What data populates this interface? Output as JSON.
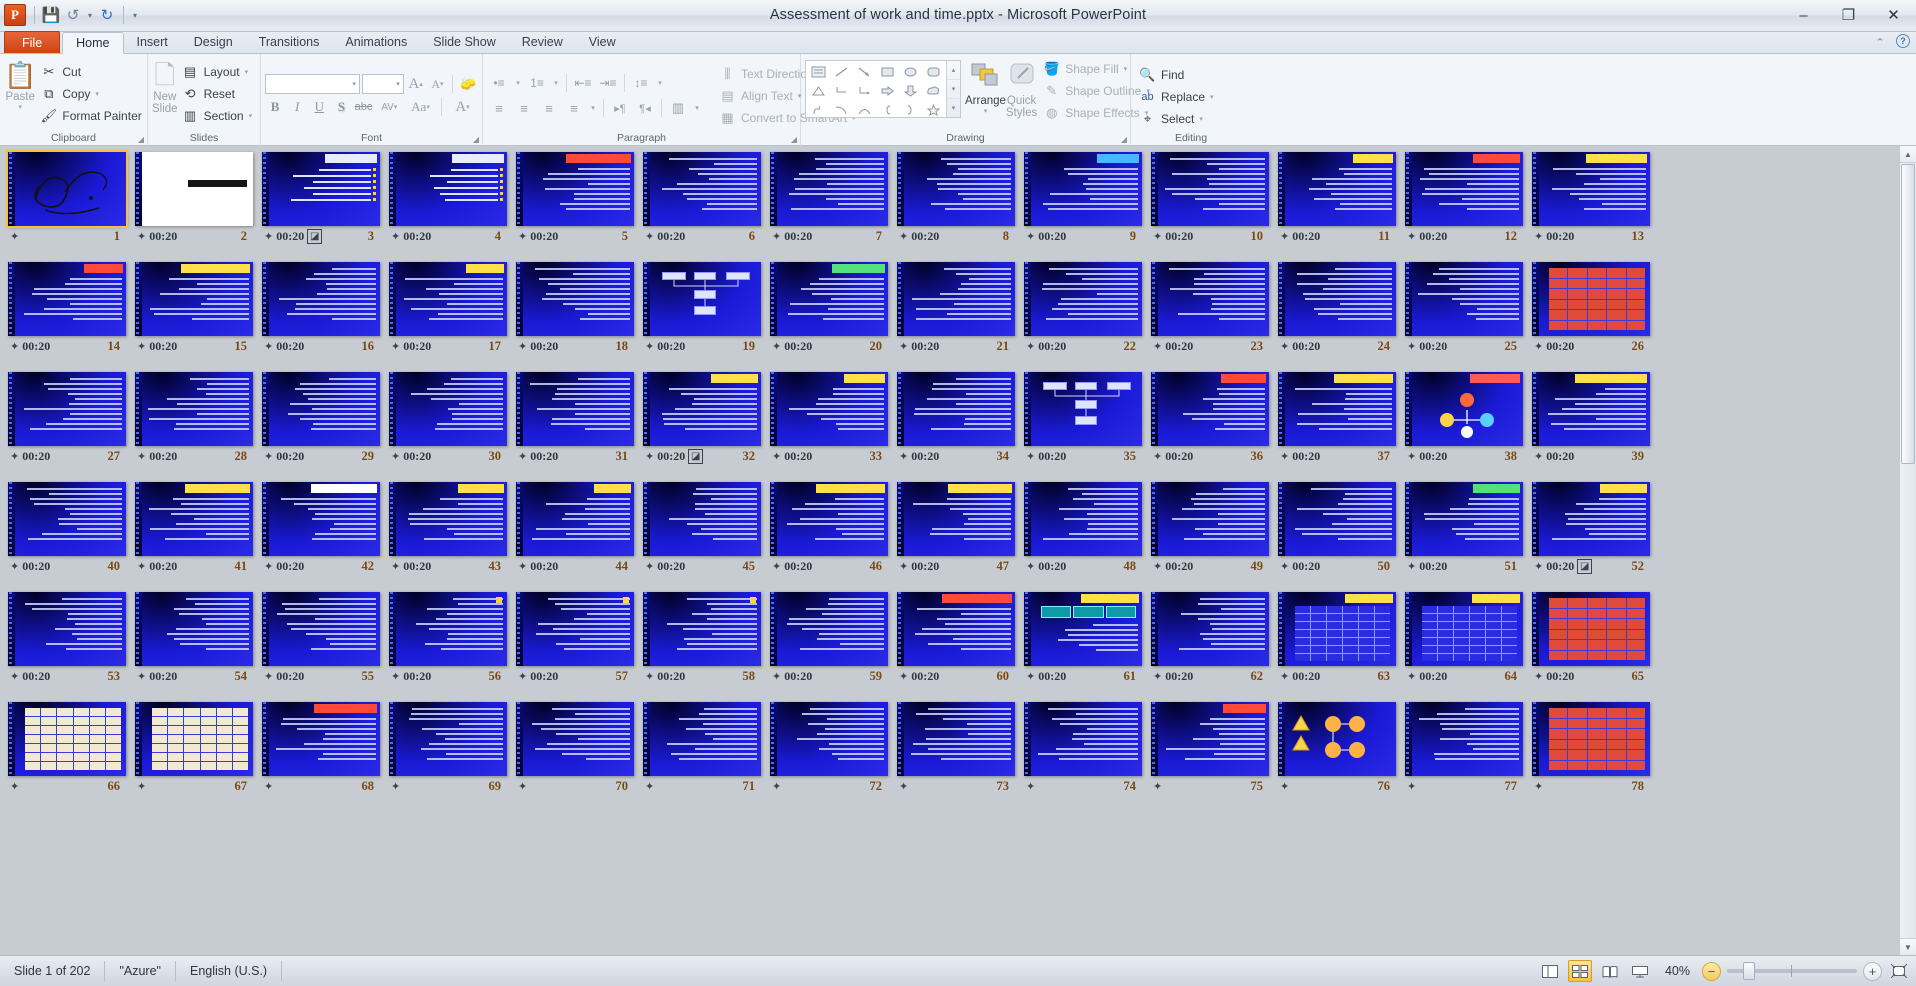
{
  "window": {
    "title": "Assessment of work and time.pptx  -  Microsoft PowerPoint",
    "minimize": "–",
    "restore": "❐",
    "close": "✕"
  },
  "qat": {
    "app_icon": "P",
    "save": "💾",
    "undo": "↺",
    "undo_caret": "▾",
    "redo": "↻",
    "customize": "▾"
  },
  "tabs": [
    {
      "label": "File",
      "kind": "file"
    },
    {
      "label": "Home",
      "kind": "active"
    },
    {
      "label": "Insert",
      "kind": "normal"
    },
    {
      "label": "Design",
      "kind": "normal"
    },
    {
      "label": "Transitions",
      "kind": "normal"
    },
    {
      "label": "Animations",
      "kind": "normal"
    },
    {
      "label": "Slide Show",
      "kind": "normal"
    },
    {
      "label": "Review",
      "kind": "normal"
    },
    {
      "label": "View",
      "kind": "normal"
    }
  ],
  "tabstrip_right": {
    "minimize_ribbon": "⌃",
    "help": "?"
  },
  "ribbon": {
    "clipboard": {
      "label": "Clipboard",
      "paste": "Paste",
      "paste_caret": "▾",
      "cut": "Cut",
      "copy": "Copy",
      "copy_caret": "▾",
      "format_painter": "Format Painter",
      "dialog_launcher": "◢"
    },
    "slides": {
      "label": "Slides",
      "new_slide_line1": "New",
      "new_slide_line2": "Slide",
      "new_slide_caret": "▾",
      "layout": "Layout",
      "layout_caret": "▾",
      "reset": "Reset",
      "section": "Section",
      "section_caret": "▾"
    },
    "font": {
      "label": "Font",
      "font_name_value": "",
      "font_size_value": "",
      "grow_font": "A",
      "shrink_font": "A",
      "clear_formatting": "A",
      "bold": "B",
      "italic": "I",
      "underline": "U",
      "shadow": "S",
      "strikethrough": "abc",
      "character_spacing": "AV",
      "change_case": "Aa",
      "font_color": "A",
      "dialog_launcher": "◢"
    },
    "paragraph": {
      "label": "Paragraph",
      "bullets": "•≡",
      "numbering": "1≡",
      "decrease_indent": "⇤≡",
      "increase_indent": "⇥≡",
      "line_spacing": "↕≡",
      "align_left": "≡",
      "align_center": "≡",
      "align_right": "≡",
      "justify": "≡",
      "text_direction_ltr": "▸¶",
      "text_direction_rtl": "¶◂",
      "columns": "▥",
      "text_direction": "Text Direction",
      "align_text": "Align Text",
      "convert_to_smartart": "Convert to SmartArt",
      "dialog_launcher": "◢"
    },
    "drawing": {
      "label": "Drawing",
      "arrange": "Arrange",
      "arrange_caret": "▾",
      "quick_styles_line1": "Quick",
      "quick_styles_line2": "Styles",
      "quick_styles_caret": "▾",
      "shape_fill": "Shape Fill",
      "shape_outline": "Shape Outline",
      "shape_effects": "Shape Effects",
      "dialog_launcher": "◢",
      "shapes": [
        "textbox-shape",
        "line-shape",
        "arrow-shape",
        "rectangle-shape",
        "oval-shape",
        "rounded-rectangle-shape",
        "triangle-shape",
        "elbow-connector-shape",
        "elbow-arrow-connector-shape",
        "right-arrow-shape",
        "down-arrow-shape",
        "cloud-shape",
        "freeform-shape",
        "curve-shape",
        "arc-shape",
        "left-brace-shape",
        "right-brace-shape",
        "star-shape"
      ],
      "gallery_up": "▴",
      "gallery_down": "▾",
      "gallery_more": "▾"
    },
    "editing": {
      "label": "Editing",
      "find": "Find",
      "replace": "Replace",
      "replace_caret": "▾",
      "select": "Select",
      "select_caret": "▾"
    }
  },
  "sorter": {
    "timing_label": "00:20",
    "slide_count": 78,
    "selected_index": 1,
    "transition_icon": "◪",
    "star_icon": "✦",
    "slides": [
      {
        "n": 1,
        "style": "calligraphy",
        "timing": "",
        "sel": true,
        "trans": false
      },
      {
        "n": 2,
        "style": "white-title",
        "timing": "00:20",
        "sel": false,
        "trans": false
      },
      {
        "n": 3,
        "style": "bullets",
        "timing": "00:20",
        "sel": false,
        "trans": true
      },
      {
        "n": 4,
        "style": "bullets",
        "timing": "00:20",
        "sel": false,
        "trans": false
      },
      {
        "n": 5,
        "style": "title-red",
        "timing": "00:20",
        "sel": false,
        "trans": false
      },
      {
        "n": 6,
        "style": "text",
        "timing": "00:20",
        "sel": false,
        "trans": false
      },
      {
        "n": 7,
        "style": "text",
        "timing": "00:20",
        "sel": false,
        "trans": false
      },
      {
        "n": 8,
        "style": "text",
        "timing": "00:20",
        "sel": false,
        "trans": false
      },
      {
        "n": 9,
        "style": "text-blue",
        "timing": "00:20",
        "sel": false,
        "trans": false
      },
      {
        "n": 10,
        "style": "text",
        "timing": "00:20",
        "sel": false,
        "trans": false
      },
      {
        "n": 11,
        "style": "title-yellow",
        "timing": "00:20",
        "sel": false,
        "trans": false
      },
      {
        "n": 12,
        "style": "title-red",
        "timing": "00:20",
        "sel": false,
        "trans": false
      },
      {
        "n": 13,
        "style": "title-yellow",
        "timing": "00:20",
        "sel": false,
        "trans": false
      },
      {
        "n": 14,
        "style": "title-red",
        "timing": "00:20",
        "sel": false,
        "trans": false
      },
      {
        "n": 15,
        "style": "title-yellow",
        "timing": "00:20",
        "sel": false,
        "trans": false
      },
      {
        "n": 16,
        "style": "text",
        "timing": "00:20",
        "sel": false,
        "trans": false
      },
      {
        "n": 17,
        "style": "title-yellow",
        "timing": "00:20",
        "sel": false,
        "trans": false
      },
      {
        "n": 18,
        "style": "text",
        "timing": "00:20",
        "sel": false,
        "trans": false
      },
      {
        "n": 19,
        "style": "diagram",
        "timing": "00:20",
        "sel": false,
        "trans": false
      },
      {
        "n": 20,
        "style": "title-green",
        "timing": "00:20",
        "sel": false,
        "trans": false
      },
      {
        "n": 21,
        "style": "text",
        "timing": "00:20",
        "sel": false,
        "trans": false
      },
      {
        "n": 22,
        "style": "text",
        "timing": "00:20",
        "sel": false,
        "trans": false
      },
      {
        "n": 23,
        "style": "text",
        "timing": "00:20",
        "sel": false,
        "trans": false
      },
      {
        "n": 24,
        "style": "text",
        "timing": "00:20",
        "sel": false,
        "trans": false
      },
      {
        "n": 25,
        "style": "text",
        "timing": "00:20",
        "sel": false,
        "trans": false
      },
      {
        "n": 26,
        "style": "table-red",
        "timing": "00:20",
        "sel": false,
        "trans": false
      },
      {
        "n": 27,
        "style": "text",
        "timing": "00:20",
        "sel": false,
        "trans": false
      },
      {
        "n": 28,
        "style": "text",
        "timing": "00:20",
        "sel": false,
        "trans": false
      },
      {
        "n": 29,
        "style": "text",
        "timing": "00:20",
        "sel": false,
        "trans": false
      },
      {
        "n": 30,
        "style": "text",
        "timing": "00:20",
        "sel": false,
        "trans": false
      },
      {
        "n": 31,
        "style": "text",
        "timing": "00:20",
        "sel": false,
        "trans": false
      },
      {
        "n": 32,
        "style": "title-yellow",
        "timing": "00:20",
        "sel": false,
        "trans": true
      },
      {
        "n": 33,
        "style": "title-yellow",
        "timing": "00:20",
        "sel": false,
        "trans": false
      },
      {
        "n": 34,
        "style": "text",
        "timing": "00:20",
        "sel": false,
        "trans": false
      },
      {
        "n": 35,
        "style": "diagram",
        "timing": "00:20",
        "sel": false,
        "trans": false
      },
      {
        "n": 36,
        "style": "title-red",
        "timing": "00:20",
        "sel": false,
        "trans": false
      },
      {
        "n": 37,
        "style": "title-yellow",
        "timing": "00:20",
        "sel": false,
        "trans": false
      },
      {
        "n": 38,
        "style": "circle-diag",
        "timing": "00:20",
        "sel": false,
        "trans": false
      },
      {
        "n": 39,
        "style": "title-yellow",
        "timing": "00:20",
        "sel": false,
        "trans": false
      },
      {
        "n": 40,
        "style": "text",
        "timing": "00:20",
        "sel": false,
        "trans": false
      },
      {
        "n": 41,
        "style": "title-yellow",
        "timing": "00:20",
        "sel": false,
        "trans": false
      },
      {
        "n": 42,
        "style": "title-white",
        "timing": "00:20",
        "sel": false,
        "trans": false
      },
      {
        "n": 43,
        "style": "title-yellow",
        "timing": "00:20",
        "sel": false,
        "trans": false
      },
      {
        "n": 44,
        "style": "title-yellow",
        "timing": "00:20",
        "sel": false,
        "trans": false
      },
      {
        "n": 45,
        "style": "text",
        "timing": "00:20",
        "sel": false,
        "trans": false
      },
      {
        "n": 46,
        "style": "title-yellow",
        "timing": "00:20",
        "sel": false,
        "trans": false
      },
      {
        "n": 47,
        "style": "title-yellow",
        "timing": "00:20",
        "sel": false,
        "trans": false
      },
      {
        "n": 48,
        "style": "text",
        "timing": "00:20",
        "sel": false,
        "trans": false
      },
      {
        "n": 49,
        "style": "text",
        "timing": "00:20",
        "sel": false,
        "trans": false
      },
      {
        "n": 50,
        "style": "text",
        "timing": "00:20",
        "sel": false,
        "trans": false
      },
      {
        "n": 51,
        "style": "title-green",
        "timing": "00:20",
        "sel": false,
        "trans": false
      },
      {
        "n": 52,
        "style": "title-yellow",
        "timing": "00:20",
        "sel": false,
        "trans": true
      },
      {
        "n": 53,
        "style": "text",
        "timing": "00:20",
        "sel": false,
        "trans": false
      },
      {
        "n": 54,
        "style": "text",
        "timing": "00:20",
        "sel": false,
        "trans": false
      },
      {
        "n": 55,
        "style": "text",
        "timing": "00:20",
        "sel": false,
        "trans": false
      },
      {
        "n": 56,
        "style": "text-note",
        "timing": "00:20",
        "sel": false,
        "trans": false
      },
      {
        "n": 57,
        "style": "text-note",
        "timing": "00:20",
        "sel": false,
        "trans": false
      },
      {
        "n": 58,
        "style": "text-note",
        "timing": "00:20",
        "sel": false,
        "trans": false
      },
      {
        "n": 59,
        "style": "text",
        "timing": "00:20",
        "sel": false,
        "trans": false
      },
      {
        "n": 60,
        "style": "title-red",
        "timing": "00:20",
        "sel": false,
        "trans": false
      },
      {
        "n": 61,
        "style": "diagram-box",
        "timing": "00:20",
        "sel": false,
        "trans": false
      },
      {
        "n": 62,
        "style": "text",
        "timing": "00:20",
        "sel": false,
        "trans": false
      },
      {
        "n": 63,
        "style": "table-grid",
        "timing": "00:20",
        "sel": false,
        "trans": false
      },
      {
        "n": 64,
        "style": "table-grid",
        "timing": "00:20",
        "sel": false,
        "trans": false
      },
      {
        "n": 65,
        "style": "table-red",
        "timing": "00:20",
        "sel": false,
        "trans": false
      },
      {
        "n": 66,
        "style": "table-tan",
        "timing": "",
        "sel": false,
        "trans": false
      },
      {
        "n": 67,
        "style": "table-tan",
        "timing": "",
        "sel": false,
        "trans": false
      },
      {
        "n": 68,
        "style": "title-red",
        "timing": "",
        "sel": false,
        "trans": false
      },
      {
        "n": 69,
        "style": "text",
        "timing": "",
        "sel": false,
        "trans": false
      },
      {
        "n": 70,
        "style": "text",
        "timing": "",
        "sel": false,
        "trans": false
      },
      {
        "n": 71,
        "style": "text",
        "timing": "",
        "sel": false,
        "trans": false
      },
      {
        "n": 72,
        "style": "text",
        "timing": "",
        "sel": false,
        "trans": false
      },
      {
        "n": 73,
        "style": "text",
        "timing": "",
        "sel": false,
        "trans": false
      },
      {
        "n": 74,
        "style": "text",
        "timing": "",
        "sel": false,
        "trans": false
      },
      {
        "n": 75,
        "style": "title-red",
        "timing": "",
        "sel": false,
        "trans": false
      },
      {
        "n": 76,
        "style": "flow-diag",
        "timing": "",
        "sel": false,
        "trans": false
      },
      {
        "n": 77,
        "style": "text",
        "timing": "",
        "sel": false,
        "trans": false
      },
      {
        "n": 78,
        "style": "table-red",
        "timing": "",
        "sel": false,
        "trans": false
      }
    ]
  },
  "status": {
    "slide_indicator": "Slide 1 of 202",
    "theme": "\"Azure\"",
    "language": "English (U.S.)",
    "zoom_level": "40%",
    "views": [
      {
        "name": "normal-view",
        "glyph": "▤"
      },
      {
        "name": "slide-sorter-view",
        "glyph": "▦",
        "active": true
      },
      {
        "name": "reading-view",
        "glyph": "📖"
      },
      {
        "name": "slide-show-view",
        "glyph": "🖵"
      }
    ],
    "zoom_out": "−",
    "zoom_in": "+",
    "fit_to_window": "⛶"
  },
  "colors": {
    "accent_orange": "#cf4310",
    "slide_blue": "#1a1ad6",
    "selection_gold": "#f5c141",
    "ribbon_bg": "#f2f5f9",
    "sorter_bg": "#c7ccd3"
  }
}
